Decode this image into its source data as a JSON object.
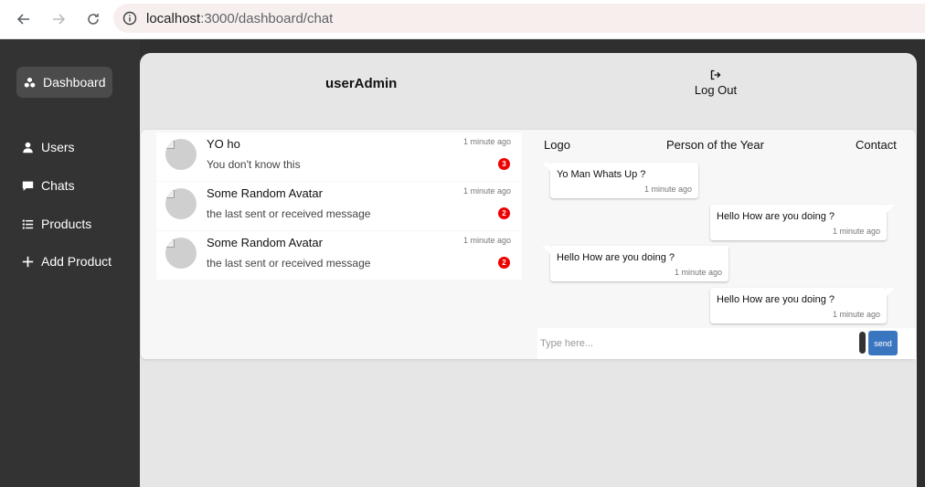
{
  "browser": {
    "url_host": "localhost",
    "url_rest": ":3000/dashboard/chat"
  },
  "sidebar": {
    "items": [
      {
        "label": "Dashboard",
        "icon": "cubes-icon"
      },
      {
        "label": "Users",
        "icon": "user-icon"
      },
      {
        "label": "Chats",
        "icon": "comment-icon"
      },
      {
        "label": "Products",
        "icon": "list-icon"
      },
      {
        "label": "Add Product",
        "icon": "plus-icon"
      }
    ]
  },
  "header": {
    "username": "userAdmin",
    "logout_label": "Log Out"
  },
  "conversations": [
    {
      "name": "YO ho",
      "message": "You don't know this",
      "time": "1 minute ago",
      "unread": "3"
    },
    {
      "name": "Some Random Avatar",
      "message": "the last sent or received message",
      "time": "1 minute ago",
      "unread": "2"
    },
    {
      "name": "Some Random Avatar",
      "message": "the last sent or received message",
      "time": "1 minute ago",
      "unread": "2"
    }
  ],
  "chat": {
    "header": {
      "left": "Logo",
      "center": "Person of the Year",
      "right": "Contact"
    },
    "messages": [
      {
        "text": "Yo Man Whats Up ?",
        "time": "1 minute ago",
        "side": "left"
      },
      {
        "text": "Hello How are you doing ?",
        "time": "1 minute ago",
        "side": "right"
      },
      {
        "text": "Hello How are you doing ?",
        "time": "1 minute ago",
        "side": "left"
      },
      {
        "text": "Hello How are you doing ?",
        "time": "1 minute ago",
        "side": "right"
      }
    ],
    "input_placeholder": "Type here...",
    "send_label": "send"
  },
  "colors": {
    "sidebar_bg": "#333333",
    "main_bg": "#e6e6e6",
    "badge": "#ee0000",
    "send_button": "#3a76c0"
  }
}
